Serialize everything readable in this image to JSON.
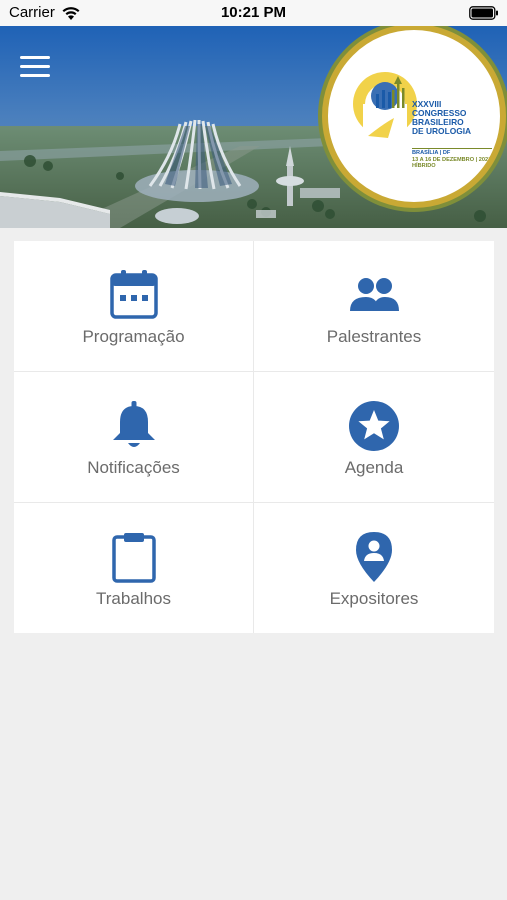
{
  "status_bar": {
    "carrier": "Carrier",
    "time": "10:21 PM"
  },
  "banner": {
    "logo": {
      "title_lines": [
        "XXXVIII",
        "CONGRESSO",
        "BRASILEIRO",
        "DE UROLOGIA"
      ],
      "sub_lines": [
        "BRASÍLIA | DF",
        "13 A 16 DE DEZEMBRO | 2021",
        "HÍBRIDO"
      ]
    }
  },
  "menu": {
    "items": [
      {
        "label": "Programação",
        "icon": "calendar-icon"
      },
      {
        "label": "Palestrantes",
        "icon": "people-icon"
      },
      {
        "label": "Notificações",
        "icon": "bell-icon"
      },
      {
        "label": "Agenda",
        "icon": "star-icon"
      },
      {
        "label": "Trabalhos",
        "icon": "clipboard-icon"
      },
      {
        "label": "Expositores",
        "icon": "location-pin-icon"
      }
    ]
  },
  "colors": {
    "accent": "#2f66ad",
    "label": "#6b6b6b",
    "background": "#efefef"
  }
}
